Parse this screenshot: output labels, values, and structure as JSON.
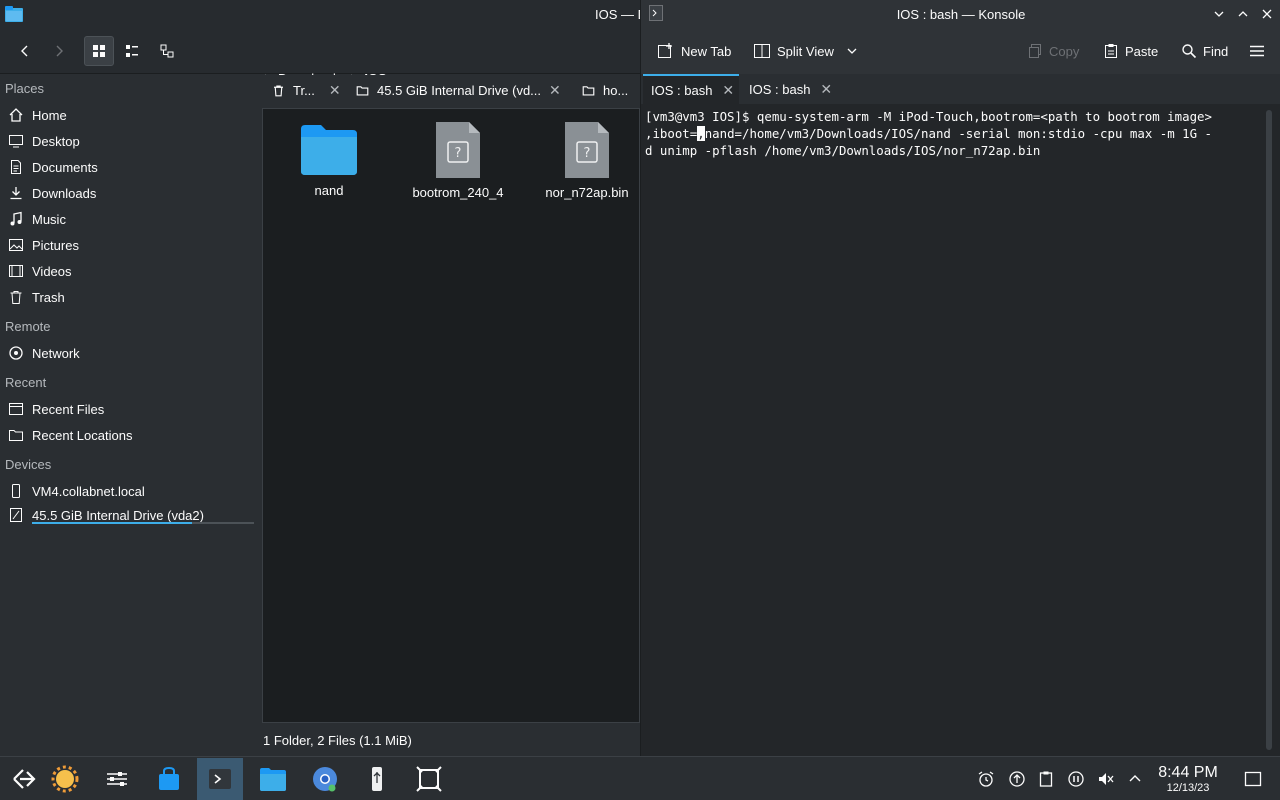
{
  "dolphin": {
    "title": "IOS — D",
    "breadcrumb": {
      "parent": "Downloads",
      "current": "IOS"
    },
    "places": {
      "headers": {
        "places": "Places",
        "remote": "Remote",
        "recent": "Recent",
        "devices": "Devices"
      },
      "items": {
        "home": "Home",
        "desktop": "Desktop",
        "documents": "Documents",
        "downloads": "Downloads",
        "music": "Music",
        "pictures": "Pictures",
        "videos": "Videos",
        "trash": "Trash",
        "network": "Network",
        "recent_files": "Recent Files",
        "recent_locations": "Recent Locations",
        "device1": "VM4.collabnet.local",
        "device2": "45.5 GiB Internal Drive (vda2)"
      },
      "drive_usage": 0.72
    },
    "tabs": [
      "Tr...",
      "45.5 GiB Internal Drive (vd...",
      "ho..."
    ],
    "files": [
      {
        "name": "nand",
        "type": "folder"
      },
      {
        "name": "bootrom_240_4",
        "type": "unknown"
      },
      {
        "name": "nor_n72ap.bin",
        "type": "unknown"
      }
    ],
    "status": "1 Folder, 2 Files (1.1 MiB)"
  },
  "konsole": {
    "title": "IOS : bash — Konsole",
    "toolbar": {
      "new_tab": "New Tab",
      "split_view": "Split View",
      "copy": "Copy",
      "paste": "Paste",
      "find": "Find"
    },
    "tabs": [
      "IOS : bash",
      "IOS : bash"
    ],
    "lines": [
      "[vm3@vm3 IOS]$ qemu-system-arm -M iPod-Touch,bootrom=<path to bootrom image>",
      ",iboot=",
      "d unimp -pflash /home/vm3/Downloads/IOS/nor_n72ap.bin"
    ],
    "line2_after_cursor": "nand=/home/vm3/Downloads/IOS/nand -serial mon:stdio -cpu max -m 1G -",
    "cursor_char": ","
  },
  "taskbar": {
    "time": "8:44 PM",
    "date": "12/13/23"
  },
  "colors": {
    "accent": "#3daee9",
    "folder": "#3daee9",
    "background": "#2a2e32"
  }
}
